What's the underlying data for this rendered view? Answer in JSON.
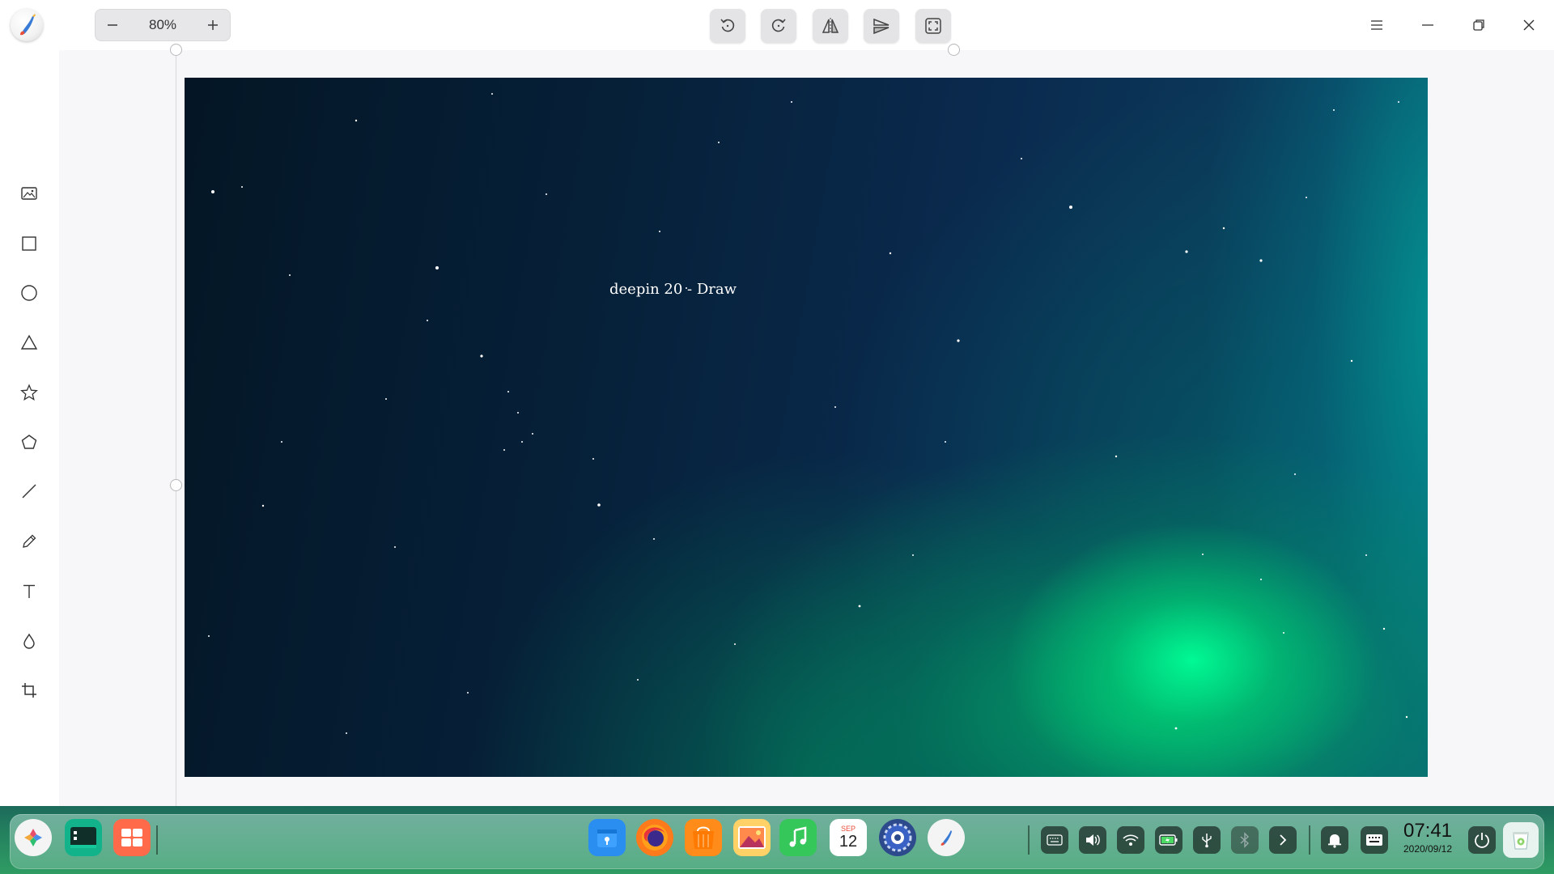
{
  "window": {
    "app_icon": "deepin-draw-logo",
    "zoom": {
      "value": "80%",
      "minus_icon": "minus-icon",
      "plus_icon": "plus-icon"
    },
    "toolbar_buttons": [
      "rotate-left-icon",
      "rotate-right-icon",
      "flip-horizontal-icon",
      "flip-vertical-icon",
      "fit-window-icon"
    ],
    "window_controls": [
      "menu-icon",
      "minimize-icon",
      "restore-icon",
      "close-icon"
    ]
  },
  "left_tools": [
    {
      "name": "import-image",
      "icon": "image-icon"
    },
    {
      "name": "rectangle",
      "icon": "rectangle-icon"
    },
    {
      "name": "ellipse",
      "icon": "ellipse-icon"
    },
    {
      "name": "triangle",
      "icon": "triangle-icon"
    },
    {
      "name": "star",
      "icon": "star-icon"
    },
    {
      "name": "polygon",
      "icon": "pentagon-icon"
    },
    {
      "name": "line",
      "icon": "line-icon"
    },
    {
      "name": "pencil",
      "icon": "pencil-icon"
    },
    {
      "name": "text",
      "icon": "text-icon"
    },
    {
      "name": "blur",
      "icon": "drop-icon"
    },
    {
      "name": "crop",
      "icon": "crop-icon"
    }
  ],
  "canvas": {
    "text": "deepin 20 - Draw",
    "background": "aurora-night-sky"
  },
  "dock": {
    "apps": [
      "launcher-icon",
      "terminal-icon",
      "multitasking-icon",
      "app-store-icon",
      "firefox-icon",
      "file-manager-icon",
      "image-viewer-icon",
      "music-icon",
      "calendar-icon",
      "control-center-icon",
      "draw-icon"
    ],
    "calendar": {
      "month": "SEP",
      "day": "12"
    },
    "tray": [
      "keyboard-icon",
      "volume-icon",
      "wifi-icon",
      "battery-icon",
      "usb-icon",
      "bluetooth-icon",
      "chevron-right-icon",
      "notification-icon",
      "onscreen-keyboard-icon"
    ],
    "clock": {
      "time": "07:41",
      "date": "2020/09/12"
    },
    "power_icon": "power-icon",
    "trash_icon": "trash-icon"
  },
  "colors": {
    "accent": "#0081ff",
    "dock": "#2f9c63",
    "canvas_text": "#ffffff"
  }
}
